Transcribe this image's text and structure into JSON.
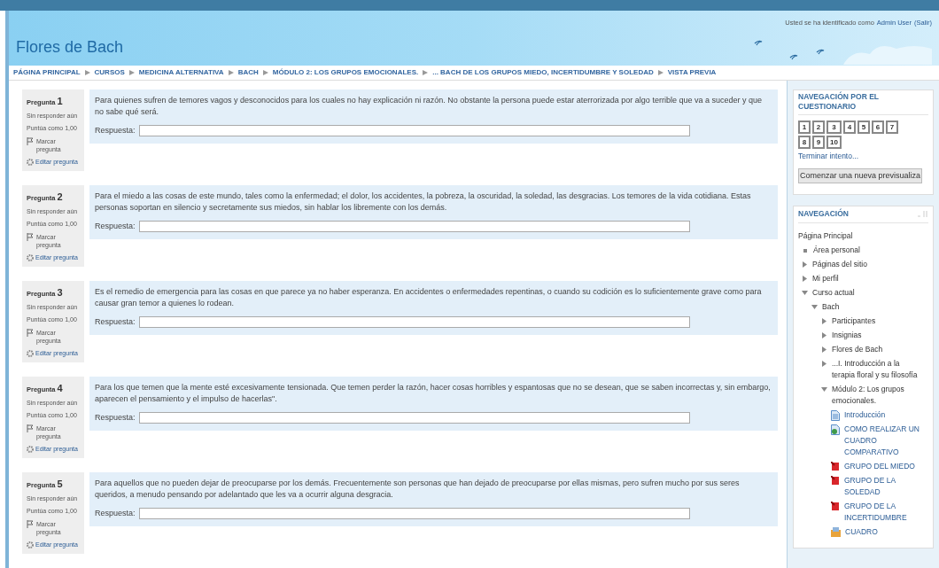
{
  "header": {
    "site_title": "Flores de Bach",
    "login": {
      "text": "Usted se ha identificado como",
      "user": "Admin User",
      "logout": "(Salir)"
    }
  },
  "breadcrumb": [
    "PÁGINA PRINCIPAL",
    "CURSOS",
    "MEDICINA ALTERNATIVA",
    "BACH",
    "MÓDULO 2: LOS GRUPOS EMOCIONALES.",
    "... BACH DE LOS GRUPOS MIEDO, INCERTIDUMBRE Y SOLEDAD",
    "VISTA PREVIA"
  ],
  "questions": [
    {
      "label": "Pregunta",
      "number": "1",
      "status": "Sin responder aún",
      "score": "Puntúa como 1,00",
      "flag": "Marcar pregunta",
      "edit": "Editar pregunta",
      "text": "Para quienes sufren de temores vagos y desconocidos para los cuales no hay explicación ni razón. No obstante la persona puede estar aterrorizada por algo terrible que va a suceder y que no sabe qué será.",
      "answer_label": "Respuesta:"
    },
    {
      "label": "Pregunta",
      "number": "2",
      "status": "Sin responder aún",
      "score": "Puntúa como 1,00",
      "flag": "Marcar pregunta",
      "edit": "Editar pregunta",
      "text": "Para el miedo a las cosas de este mundo, tales como la enfermedad; el dolor, los accidentes, la pobreza, la oscuridad, la soledad, las desgracias. Los temores de la vida cotidiana. Estas personas soportan en silencio y secretamente sus miedos, sin hablar los libremente con los demás.",
      "answer_label": "Respuesta:"
    },
    {
      "label": "Pregunta",
      "number": "3",
      "status": "Sin responder aún",
      "score": "Puntúa como 1,00",
      "flag": "Marcar pregunta",
      "edit": "Editar pregunta",
      "text": "Es el remedio de emergencia para las cosas en que parece ya no haber esperanza. En accidentes o enfermedades repentinas, o cuando su codición es lo suficientemente grave como para causar gran temor a quienes lo rodean.",
      "answer_label": "Respuesta:"
    },
    {
      "label": "Pregunta",
      "number": "4",
      "status": "Sin responder aún",
      "score": "Puntúa como 1,00",
      "flag": "Marcar pregunta",
      "edit": "Editar pregunta",
      "text": "Para los que temen que la mente esté excesivamente tensionada. Que temen perder la razón, hacer cosas horribles y espantosas que no se desean, que se saben incorrectas y, sin embargo, aparecen el pensamiento y el impulso de hacerlas\".",
      "answer_label": "Respuesta:"
    },
    {
      "label": "Pregunta",
      "number": "5",
      "status": "Sin responder aún",
      "score": "Puntúa como 1,00",
      "flag": "Marcar pregunta",
      "edit": "Editar pregunta",
      "text": "Para aquellos que no pueden dejar de preocuparse por los demás. Frecuentemente son personas que han dejado de preocuparse por ellas mismas, pero sufren mucho por sus seres queridos, a menudo pensando por adelantado que les va a ocurrir alguna desgracia.",
      "answer_label": "Respuesta:"
    }
  ],
  "quiz_navigation": {
    "title": "NAVEGACIÓN POR EL CUESTIONARIO",
    "buttons": [
      "1",
      "2",
      "3",
      "4",
      "5",
      "6",
      "7",
      "8",
      "9",
      "10"
    ],
    "finish": "Terminar intento...",
    "restart": "Comenzar una nueva previsualiza"
  },
  "navigation": {
    "title": "NAVEGACIÓN",
    "items": [
      {
        "label": "Página Principal",
        "children": [
          {
            "label": "Área personal",
            "kind": "leaf"
          },
          {
            "label": "Páginas del sitio",
            "kind": "branch",
            "expanded": false
          },
          {
            "label": "Mi perfil",
            "kind": "branch",
            "expanded": false
          },
          {
            "label": "Curso actual",
            "kind": "branch",
            "expanded": true,
            "children": [
              {
                "label": "Bach",
                "kind": "branch",
                "expanded": true,
                "children": [
                  {
                    "label": "Participantes",
                    "kind": "branch",
                    "expanded": false
                  },
                  {
                    "label": "Insignias",
                    "kind": "branch",
                    "expanded": false
                  },
                  {
                    "label": "Flores de Bach",
                    "kind": "branch",
                    "expanded": false
                  },
                  {
                    "label": "...I. Introducción a la terapia floral y su filosofía",
                    "kind": "branch",
                    "expanded": false
                  },
                  {
                    "label": "Módulo 2: Los grupos emocionales.",
                    "kind": "branch",
                    "expanded": true,
                    "children": [
                      {
                        "label": "Introducción",
                        "kind": "page"
                      },
                      {
                        "label": "COMO REALIZAR UN CUADRO COMPARATIVO",
                        "kind": "url"
                      },
                      {
                        "label": "GRUPO DEL MIEDO",
                        "kind": "quiz"
                      },
                      {
                        "label": "GRUPO DE LA SOLEDAD",
                        "kind": "quiz"
                      },
                      {
                        "label": "GRUPO DE LA INCERTIDUMBRE",
                        "kind": "quiz"
                      },
                      {
                        "label": "CUADRO",
                        "kind": "file"
                      }
                    ]
                  }
                ]
              }
            ]
          }
        ]
      }
    ]
  }
}
